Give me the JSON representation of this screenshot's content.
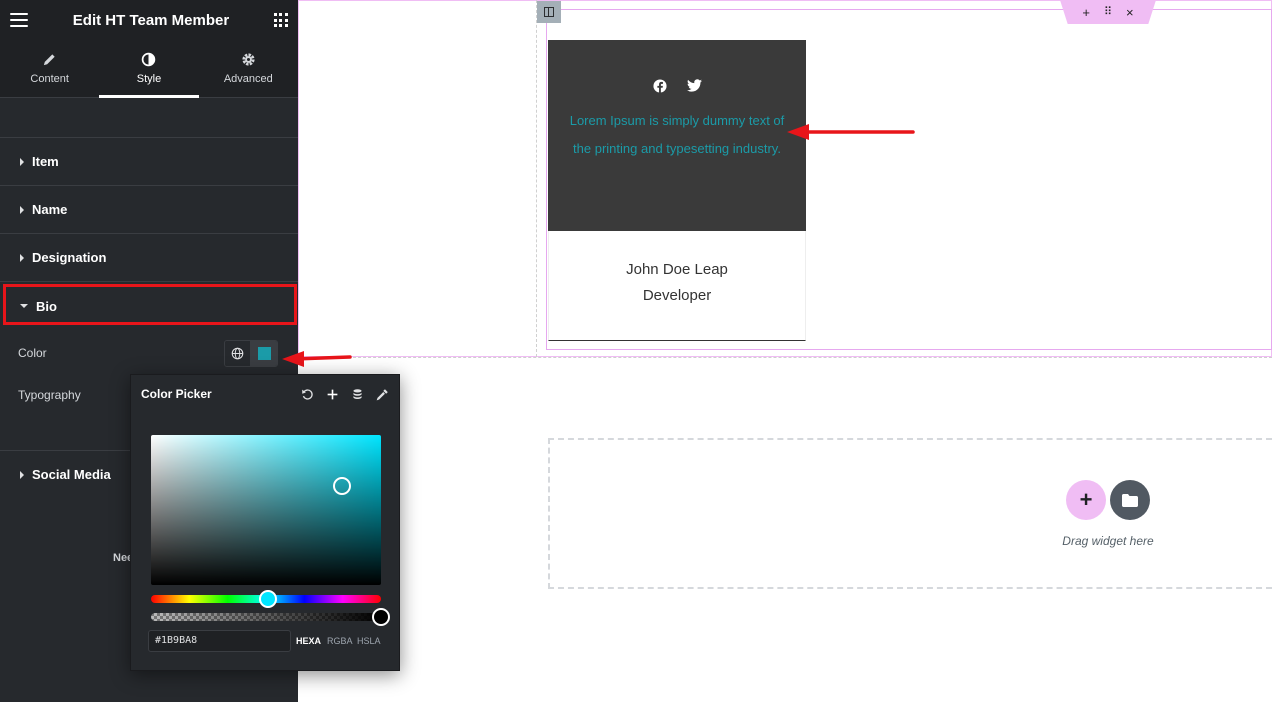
{
  "panel": {
    "title": "Edit HT Team Member",
    "tabs": [
      {
        "label": "Content",
        "icon": "pencil-icon"
      },
      {
        "label": "Style",
        "icon": "half-circle-icon",
        "active": true
      },
      {
        "label": "Advanced",
        "icon": "gear-icon"
      }
    ],
    "sections": [
      "Item",
      "Name",
      "Designation",
      "Bio",
      "Social Media"
    ],
    "bio": {
      "color_label": "Color",
      "typography_label": "Typography",
      "color_value": "#1B9BA8"
    },
    "need_text": "Nee"
  },
  "color_picker": {
    "title": "Color Picker",
    "tools": [
      "reset-icon",
      "plus-icon",
      "database-icon",
      "eyedropper-icon"
    ],
    "hex_value": "#1B9BA8",
    "formats": [
      "HEXA",
      "RGBA",
      "HSLA"
    ],
    "active_format": "HEXA",
    "hue_color": "#00e5ff",
    "alpha": 1
  },
  "canvas": {
    "section_tools": [
      "+",
      "⠿",
      "×"
    ],
    "card": {
      "bio": "Lorem Ipsum is simply dummy text of the printing and typesetting industry.",
      "name": "John Doe Leap",
      "designation": "Developer",
      "social_icons": [
        "facebook-icon",
        "twitter-icon"
      ],
      "bio_color": "#1b9ba8",
      "top_bg": "#3a3a3a"
    },
    "drop_zone": {
      "text": "Drag widget here",
      "add_label": "+"
    }
  },
  "colors": {
    "accent_pink": "#f0bdf4",
    "highlight_red": "#e8151a",
    "panel_bg": "#26292d"
  }
}
